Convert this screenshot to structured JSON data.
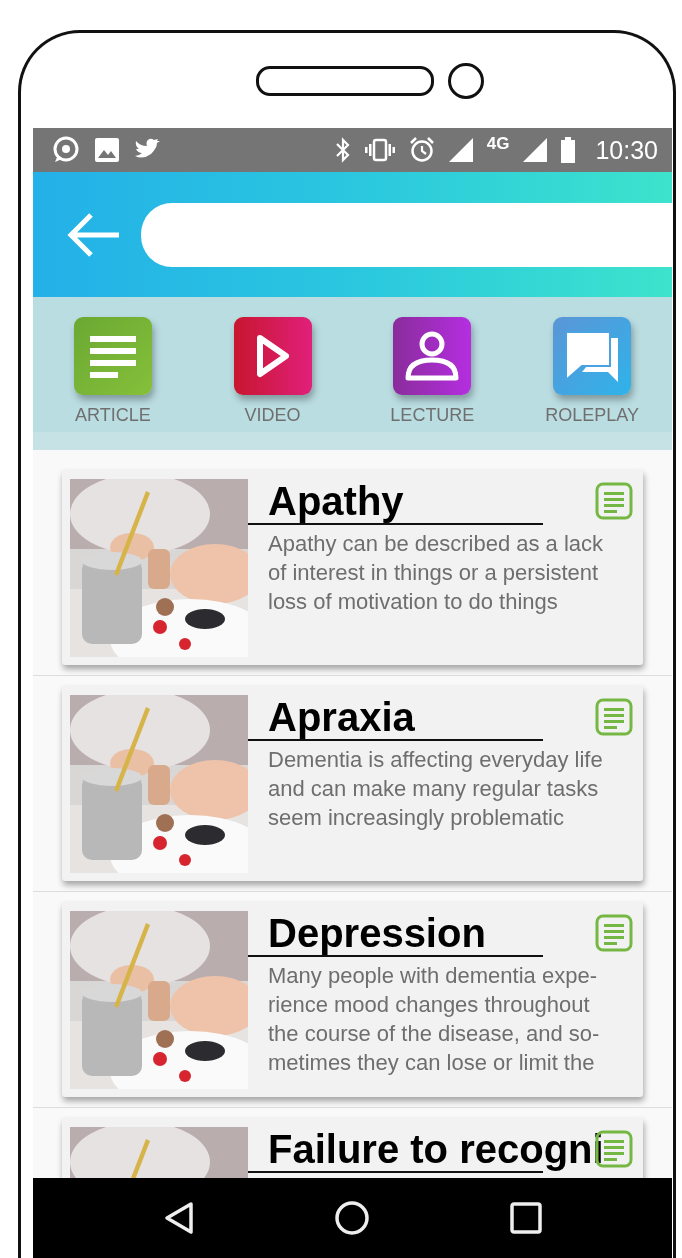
{
  "status_bar": {
    "network": "4G",
    "time": "10:30"
  },
  "categories": [
    {
      "kind": "article",
      "label": "ARTICLE"
    },
    {
      "kind": "video",
      "label": "VIDEO"
    },
    {
      "kind": "lecture",
      "label": "LECTURE"
    },
    {
      "kind": "roleplay",
      "label": "ROLEPLAY"
    }
  ],
  "cards": [
    {
      "kind": "article",
      "title": "Apathy",
      "description": "Apathy can be described as a lack\nof interest in things or a persistent\nloss of motivation to do things"
    },
    {
      "kind": "article",
      "title": "Apraxia",
      "description": "Dementia is affecting everyday life\nand can make many regular tasks\nseem increasingly problematic"
    },
    {
      "kind": "article",
      "title": "Depression",
      "description": "Many people with dementia expe-\nrience mood changes throughout\nthe course of the disease, and so-\nmetimes they can lose or limit the"
    },
    {
      "kind": "article",
      "title": "Failure to recogni"
    }
  ]
}
